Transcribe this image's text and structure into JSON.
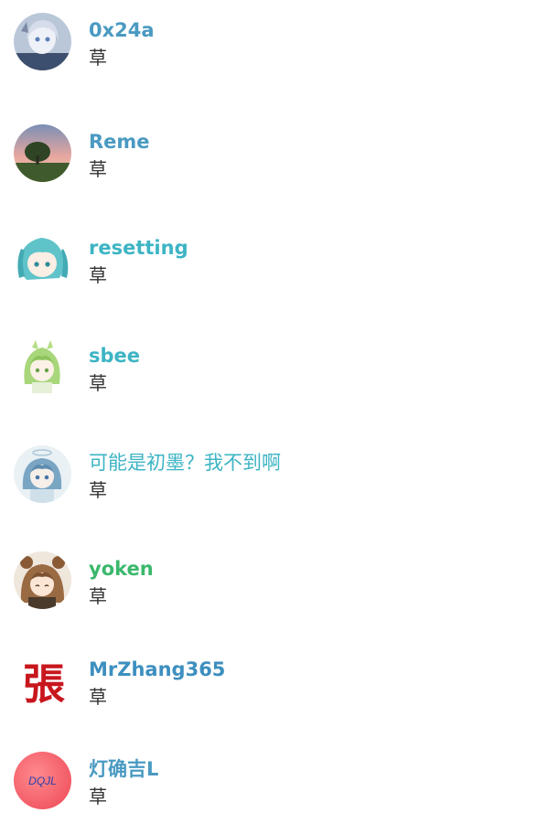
{
  "colors": {
    "name_blue": "#4a9ac2",
    "name_teal": "#3db4c4",
    "name_green": "#3bb86c",
    "name_purple_blue": "#3d8fbf",
    "message_text": "#333333"
  },
  "messages": [
    {
      "sender": "0x24a",
      "text": "草",
      "avatar_icon": "anime-avatar-icon"
    },
    {
      "sender": "Reme",
      "text": "草",
      "avatar_icon": "landscape-tree-avatar-icon"
    },
    {
      "sender": "resetting",
      "text": "草",
      "avatar_icon": "miku-avatar-icon"
    },
    {
      "sender": "sbee",
      "text": "草",
      "avatar_icon": "green-hair-anime-avatar-icon"
    },
    {
      "sender": "可能是初墨？我不到啊",
      "text": "草",
      "avatar_icon": "angel-anime-avatar-icon"
    },
    {
      "sender": "yoken",
      "text": "草",
      "avatar_icon": "bear-ears-anime-avatar-icon"
    },
    {
      "sender": "MrZhang365",
      "text": "草",
      "avatar_icon": "zhang-character-icon",
      "avatar_text": "張"
    },
    {
      "sender": "灯确吉L",
      "text": "草",
      "avatar_icon": "dqjl-avatar-icon",
      "avatar_text": "DQJL"
    }
  ]
}
